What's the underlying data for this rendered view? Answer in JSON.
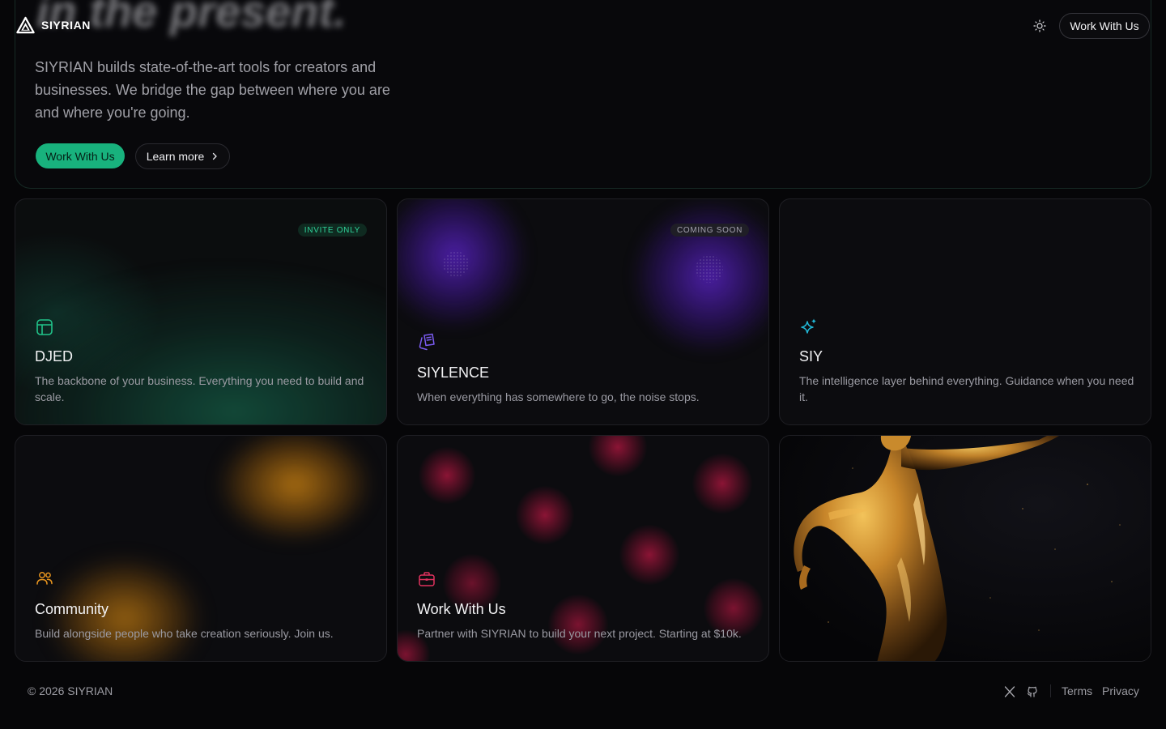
{
  "header": {
    "brand": "SIYRIAN",
    "cta_label": "Work With Us",
    "theme_icon": "sun-icon"
  },
  "hero": {
    "title": "in the present.",
    "copy": "SIYRIAN builds state-of-the-art tools for creators and businesses. We bridge the gap between where you are and where you're going.",
    "primary_label": "Work With Us",
    "secondary_label": "Learn more"
  },
  "cards": {
    "djed": {
      "badge": "INVITE ONLY",
      "title": "DJED",
      "desc": "The backbone of your business. Everything you need to build and scale.",
      "icon": "layout-icon"
    },
    "sylence": {
      "badge": "COMING SOON",
      "title": "SIYLENCE",
      "desc": "When everything has somewhere to go, the noise stops.",
      "icon": "notes-icon"
    },
    "siy": {
      "title": "SIY",
      "desc": "The intelligence layer behind everything. Guidance when you need it.",
      "icon": "sparkles-icon"
    },
    "community": {
      "title": "Community",
      "desc": "Build alongside people who take creation seriously. Join us.",
      "icon": "users-icon"
    },
    "work": {
      "title": "Work With Us",
      "desc": "Partner with SIYRIAN to build your next project. Starting at $10k.",
      "icon": "briefcase-icon"
    },
    "photo": {
      "icon": "golden-figure-image"
    }
  },
  "footer": {
    "copyright": "© 2026 SIYRIAN",
    "terms": "Terms",
    "privacy": "Privacy",
    "icons": [
      "x-icon",
      "github-icon"
    ]
  },
  "colors": {
    "accent_green": "#18b27d",
    "badge_green_text": "#2fd39a",
    "purple_glow": "#4b1fa8",
    "amber_glow": "#b8720d",
    "crimson_glow": "#a3143d",
    "siy_cyan": "#22b8d6",
    "background": "#060608"
  }
}
